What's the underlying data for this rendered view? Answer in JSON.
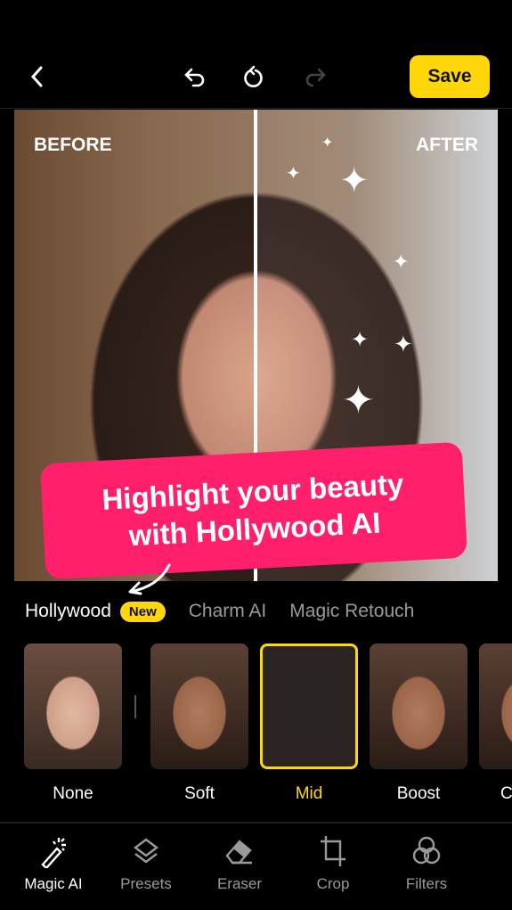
{
  "header": {
    "save_label": "Save",
    "icons": [
      "back-chevron",
      "undo",
      "reset",
      "redo"
    ]
  },
  "photo": {
    "before_label": "BEFORE",
    "after_label": "AFTER",
    "banner_line1": "Highlight your beauty",
    "banner_line2": "with Hollywood AI"
  },
  "tabs": [
    {
      "label": "Hollywood",
      "badge": "New",
      "active": true
    },
    {
      "label": "Charm AI"
    },
    {
      "label": "Magic Retouch"
    }
  ],
  "presets": [
    {
      "label": "None"
    },
    {
      "label": "Soft"
    },
    {
      "label": "Mid",
      "selected": true
    },
    {
      "label": "Boost"
    },
    {
      "label": "C"
    }
  ],
  "bottom_nav": [
    {
      "label": "Magic AI",
      "icon": "magic-wand",
      "active": true
    },
    {
      "label": "Presets",
      "icon": "layers"
    },
    {
      "label": "Eraser",
      "icon": "eraser"
    },
    {
      "label": "Crop",
      "icon": "crop"
    },
    {
      "label": "Filters",
      "icon": "filters"
    }
  ],
  "colors": {
    "accent": "#ffd60a",
    "banner": "#ff1f6a"
  }
}
